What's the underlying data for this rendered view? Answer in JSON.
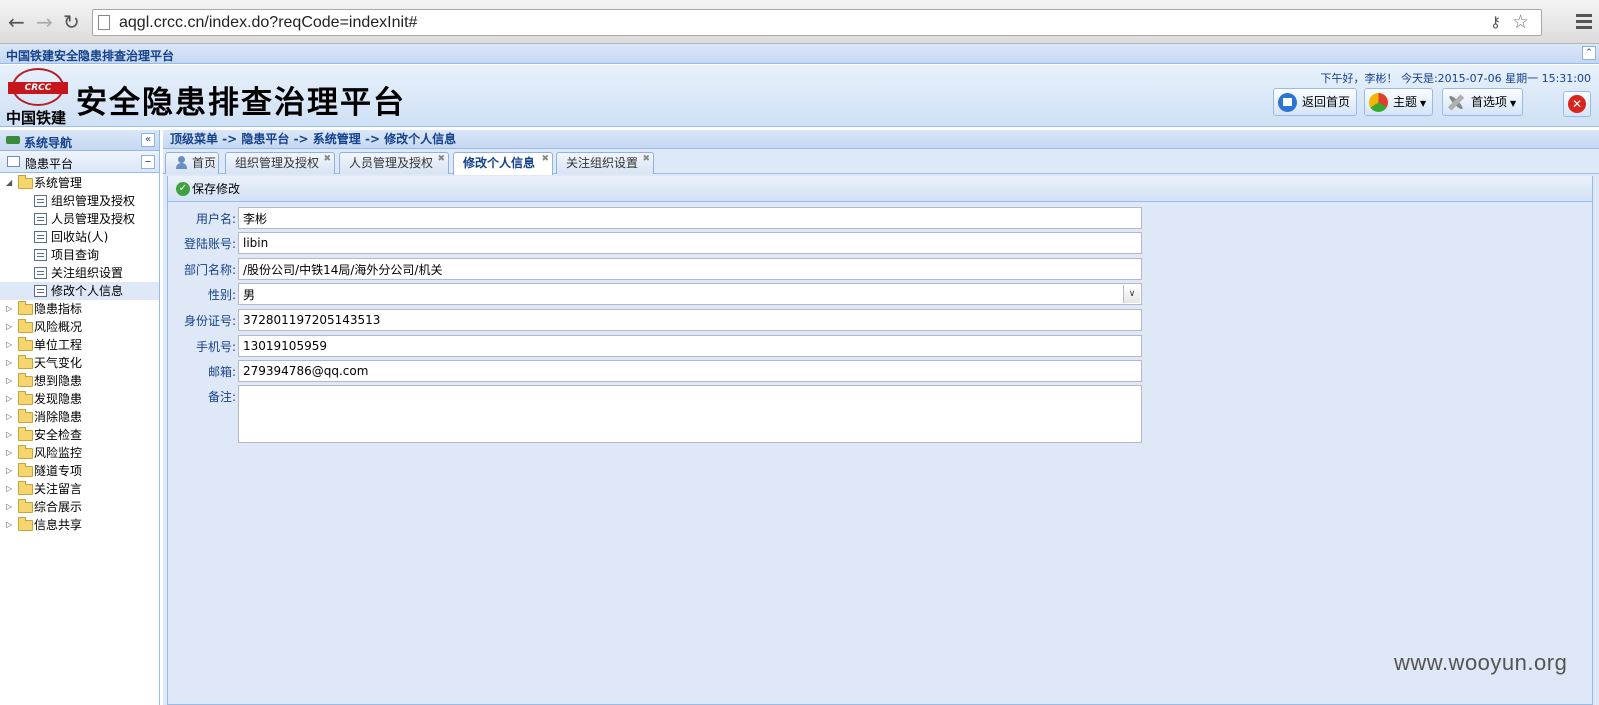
{
  "browser": {
    "back_icon": "arrow-left-icon",
    "url": "aqgl.crcc.cn/index.do?reqCode=indexInit#"
  },
  "app": {
    "title_bar": "中国铁建安全隐患排查治理平台",
    "logo_band": "CRCC",
    "logo_text": "中国铁建",
    "site_title": "安全隐患排查治理平台",
    "greeting": "下午好，李彬！ 今天是:2015-07-06 星期一 15:31:00",
    "buttons": {
      "home": "返回首页",
      "theme": "主题",
      "options": "首选项"
    }
  },
  "sidebar": {
    "header": "系统导航",
    "platform": "隐患平台",
    "tree": [
      {
        "label": "系统管理",
        "expanded": true,
        "children": [
          {
            "label": "组织管理及授权"
          },
          {
            "label": "人员管理及授权"
          },
          {
            "label": "回收站(人)"
          },
          {
            "label": "项目查询"
          },
          {
            "label": "关注组织设置"
          },
          {
            "label": "修改个人信息",
            "selected": true
          }
        ]
      },
      {
        "label": "隐患指标"
      },
      {
        "label": "风险概况"
      },
      {
        "label": "单位工程"
      },
      {
        "label": "天气变化"
      },
      {
        "label": "想到隐患"
      },
      {
        "label": "发现隐患"
      },
      {
        "label": "消除隐患"
      },
      {
        "label": "安全检查"
      },
      {
        "label": "风险监控"
      },
      {
        "label": "隧道专项"
      },
      {
        "label": "关注留言"
      },
      {
        "label": "综合展示"
      },
      {
        "label": "信息共享"
      }
    ]
  },
  "main": {
    "breadcrumb": "顶级菜单 -> 隐患平台 -> 系统管理 -> 修改个人信息",
    "tabs": [
      {
        "label": "首页"
      },
      {
        "label": "组织管理及授权"
      },
      {
        "label": "人员管理及授权"
      },
      {
        "label": "修改个人信息",
        "active": true
      },
      {
        "label": "关注组织设置"
      }
    ],
    "toolbar": {
      "save": "保存修改"
    },
    "form": {
      "username": {
        "label": "用户名:",
        "value": "李彬"
      },
      "account": {
        "label": "登陆账号:",
        "value": "libin"
      },
      "department": {
        "label": "部门名称:",
        "value": "/股份公司/中铁14局/海外分公司/机关"
      },
      "gender": {
        "label": "性别:",
        "value": "男"
      },
      "id_number": {
        "label": "身份证号:",
        "value": "372801197205143513"
      },
      "phone": {
        "label": "手机号:",
        "value": "13019105959"
      },
      "email": {
        "label": "邮箱:",
        "value": "279394786@qq.com"
      },
      "remark": {
        "label": "备注:",
        "value": ""
      }
    }
  },
  "watermark": "www.wooyun.org"
}
